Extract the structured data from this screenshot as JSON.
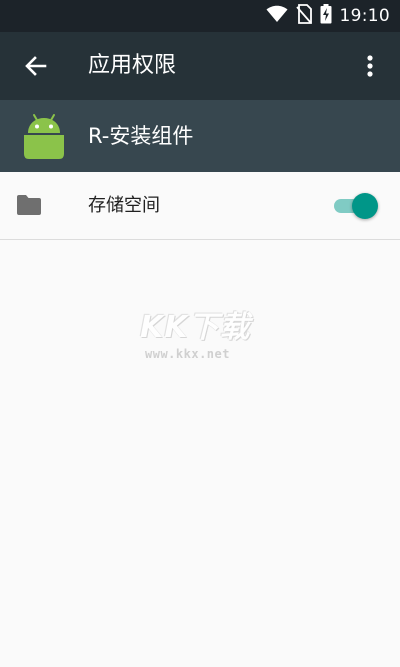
{
  "status_bar": {
    "time": "19:10",
    "icons": [
      "wifi-icon",
      "no-sim-icon",
      "battery-charging-icon"
    ]
  },
  "toolbar": {
    "title": "应用权限",
    "back_icon": "arrow-back-icon",
    "more_icon": "more-vert-icon"
  },
  "app": {
    "name": "R-安装组件",
    "icon": "android-icon",
    "icon_color": "#8bc34a"
  },
  "permissions": [
    {
      "label": "存储空间",
      "icon": "folder-icon",
      "enabled": true
    }
  ],
  "watermark": {
    "logo": "KK下载",
    "url": "www.kkx.net"
  },
  "colors": {
    "status_bar": "#1c2329",
    "toolbar": "#263238",
    "app_header": "#37474f",
    "accent": "#009688",
    "background": "#fafafa"
  }
}
